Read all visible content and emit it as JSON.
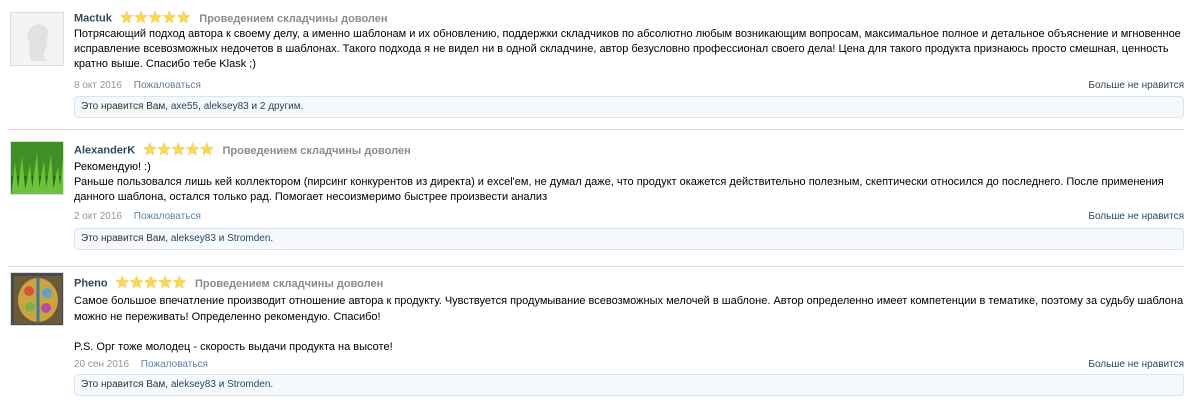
{
  "reviews": [
    {
      "username": "Mactuk",
      "stars": 5,
      "verdict": "Проведением складчины доволен",
      "text": [
        "Потрясающий подход автора к своему делу, а именно шаблонам и их обновлению, поддержки складчиков по абсолютно любым возникающим вопросам, максимальное полное и детальное объяснение и мгновенное исправление всевозможных недочетов в шаблонах. Такого подхода я не видел ни в одной складчине, автор безусловно профессионал своего дела! Цена для такого продукта признаюсь просто смешная, ценность кратно выше. Спасибо тебе Klask ;)"
      ],
      "date": "8 окт 2016",
      "report_label": "Пожаловаться",
      "dislike_label": "Больше не нравится",
      "likes_prefix": "Это нравится Вам,",
      "likes_users": [
        "axe55",
        "aleksey83"
      ],
      "likes_and": "и",
      "likes_more": "2 другим",
      "likes_end": "."
    },
    {
      "username": "AlexanderK",
      "stars": 5,
      "verdict": "Проведением складчины доволен",
      "text": [
        "Рекомендую! :)",
        "Раньше пользовался лишь кей коллектором (пирсинг конкурентов из директа) и excel'ем, не думал даже, что продукт окажется действительно полезным, скептически относился до последнего. После применения данного шаблона, остался только рад. Помогает несоизмеримо быстрее произвести анализ"
      ],
      "date": "2 окт 2016",
      "report_label": "Пожаловаться",
      "dislike_label": "Больше не нравится",
      "likes_prefix": "Это нравится Вам,",
      "likes_users": [
        "aleksey83"
      ],
      "likes_and": "и",
      "likes_more": "Stromden",
      "likes_end": "."
    },
    {
      "username": "Pheno",
      "stars": 5,
      "verdict": "Проведением складчины доволен",
      "text": [
        "Самое большое впечатление производит отношение автора к продукту. Чувствуется продумывание всевозможных мелочей в шаблоне. Автор определенно имеет компетенции в тематике, поэтому за судьбу шаблона можно не переживать! Определенно рекомендую. Спасибо!",
        "",
        "P.S. Орг тоже молодец - скорость выдачи продукта на высоте!"
      ],
      "date": "20 сен 2016",
      "report_label": "Пожаловаться",
      "dislike_label": "Больше не нравится",
      "likes_prefix": "Это нравится Вам,",
      "likes_users": [
        "aleksey83"
      ],
      "likes_and": "и",
      "likes_more": "Stromden",
      "likes_end": "."
    }
  ],
  "colors": {
    "username": "#2b485c",
    "verdict": "#8c8c8c",
    "star": "#ffd84a",
    "likes_bg": "#f5f9fd"
  }
}
